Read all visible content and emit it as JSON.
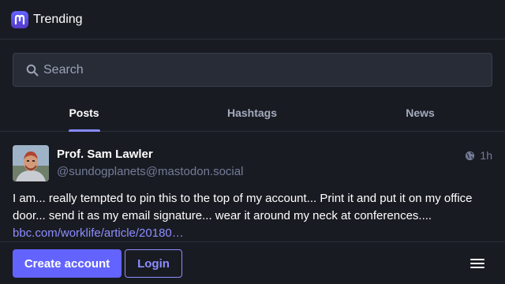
{
  "header": {
    "title": "Trending",
    "logo_icon": "mastodon-logo-icon"
  },
  "search": {
    "placeholder": "Search",
    "value": "",
    "icon": "search-icon"
  },
  "tabs": [
    {
      "label": "Posts",
      "active": true
    },
    {
      "label": "Hashtags",
      "active": false
    },
    {
      "label": "News",
      "active": false
    }
  ],
  "post": {
    "display_name": "Prof. Sam Lawler",
    "handle": "@sundogplanets@mastodon.social",
    "visibility_icon": "globe-icon",
    "time": "1h",
    "text": "I am... really tempted to pin this to the top of my account... Print it and put it on my office door... send it as my email signature... wear it around my neck at conferences....",
    "link": "bbc.com/worklife/article/20180…"
  },
  "footer": {
    "create_account_label": "Create account",
    "login_label": "Login",
    "menu_icon": "hamburger-menu-icon"
  },
  "colors": {
    "background": "#191b22",
    "accent": "#6364ff",
    "link": "#8c8dff",
    "muted": "#737d99"
  }
}
